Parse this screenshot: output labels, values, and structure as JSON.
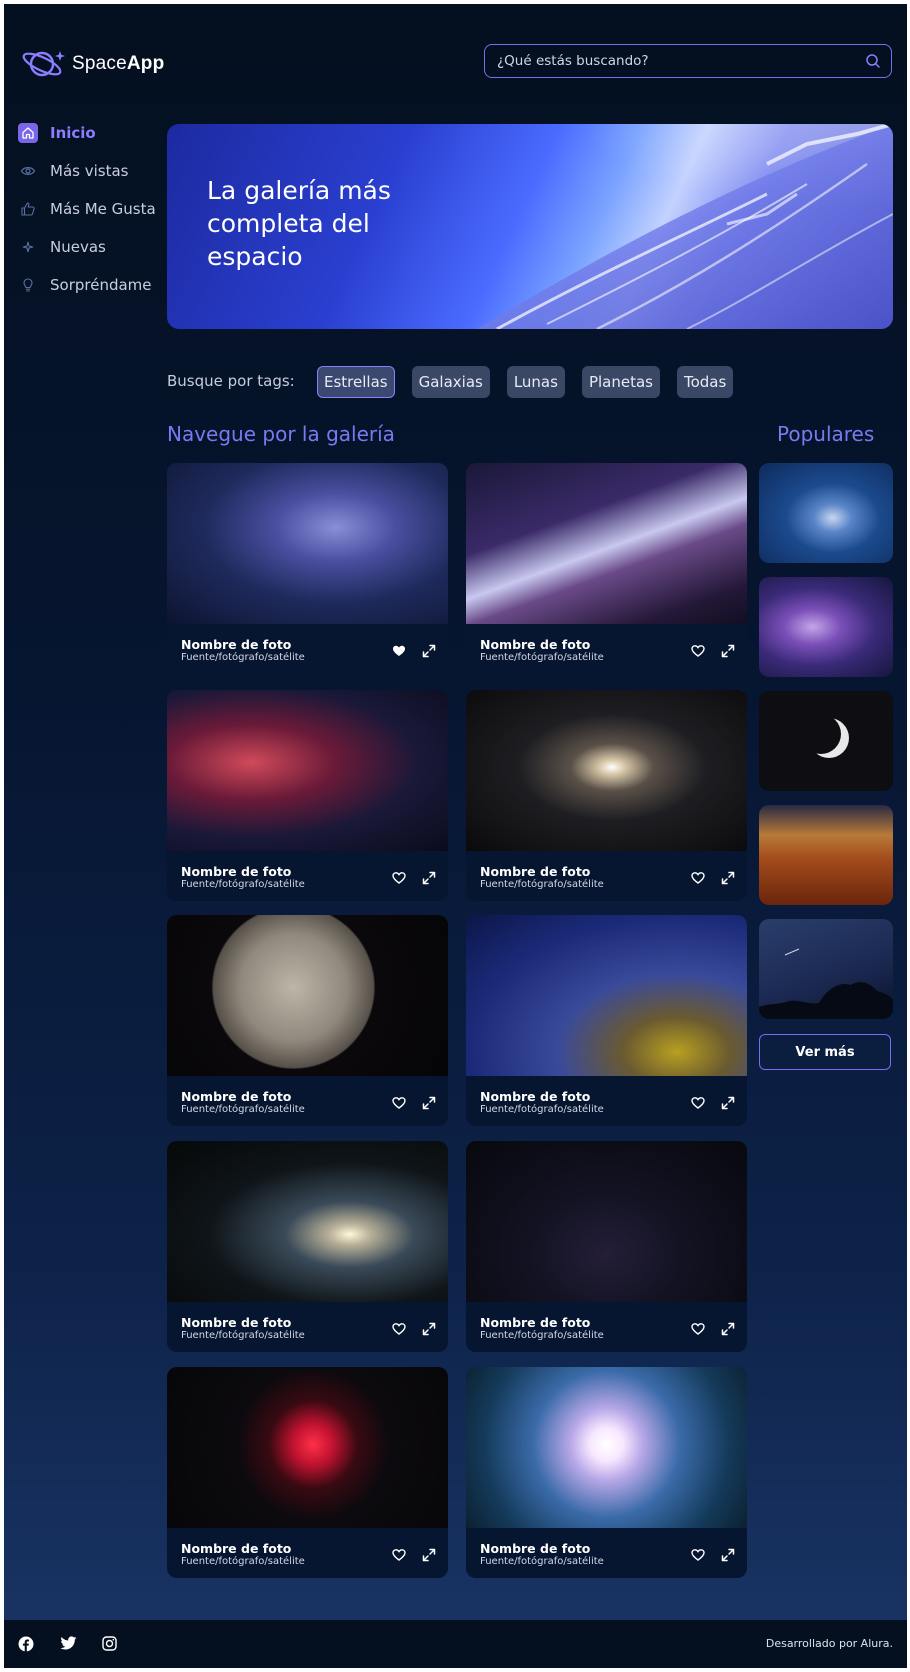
{
  "header": {
    "logo_text_light": "Space",
    "logo_text_bold": "App",
    "search_placeholder": "¿Qué estás buscando?"
  },
  "sidebar": {
    "items": [
      {
        "label": "Inicio",
        "icon": "home-icon",
        "active": true
      },
      {
        "label": "Más vistas",
        "icon": "eye-icon"
      },
      {
        "label": "Más Me Gusta",
        "icon": "thumbs-up-icon"
      },
      {
        "label": "Nuevas",
        "icon": "sparkle-icon"
      },
      {
        "label": "Sorpréndame",
        "icon": "lightbulb-icon"
      }
    ]
  },
  "banner": {
    "title": "La galería más completa del espacio"
  },
  "tags": {
    "label": "Busque por tags:",
    "items": [
      "Estrellas",
      "Galaxias",
      "Lunas",
      "Planetas",
      "Todas"
    ],
    "active": "Estrellas"
  },
  "gallery": {
    "title": "Navegue por la galería",
    "photos": [
      {
        "name": "Nombre de foto",
        "source": "Fuente/fotógrafo/satélite",
        "favorited": true
      },
      {
        "name": "Nombre de foto",
        "source": "Fuente/fotógrafo/satélite",
        "favorited": false
      },
      {
        "name": "Nombre de foto",
        "source": "Fuente/fotógrafo/satélite",
        "favorited": false
      },
      {
        "name": "Nombre de foto",
        "source": "Fuente/fotógrafo/satélite",
        "favorited": false
      },
      {
        "name": "Nombre de foto",
        "source": "Fuente/fotógrafo/satélite",
        "favorited": false
      },
      {
        "name": "Nombre de foto",
        "source": "Fuente/fotógrafo/satélite",
        "favorited": false
      },
      {
        "name": "Nombre de foto",
        "source": "Fuente/fotógrafo/satélite",
        "favorited": false
      },
      {
        "name": "Nombre de foto",
        "source": "Fuente/fotógrafo/satélite",
        "favorited": false
      },
      {
        "name": "Nombre de foto",
        "source": "Fuente/fotógrafo/satélite",
        "favorited": false
      },
      {
        "name": "Nombre de foto",
        "source": "Fuente/fotógrafo/satélite",
        "favorited": false
      }
    ]
  },
  "populares": {
    "title": "Populares",
    "button_label": "Ver más"
  },
  "footer": {
    "social": [
      "facebook-icon",
      "twitter-icon",
      "instagram-icon"
    ],
    "credit": "Desarrollado por Alura."
  },
  "colors": {
    "accent": "#7b6cf0",
    "background": "#04101f",
    "tag_bg": "#3a4866"
  }
}
